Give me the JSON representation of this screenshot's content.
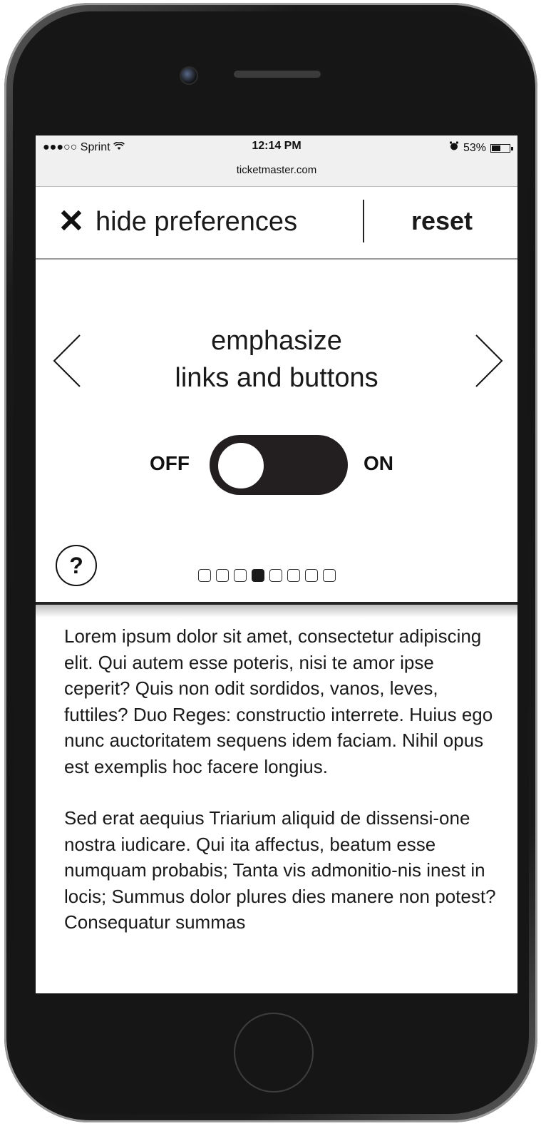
{
  "status_bar": {
    "carrier": "●●●○○ Sprint",
    "time": "12:14 PM",
    "url": "ticketmaster.com",
    "battery": "53%",
    "wifi_icon": "wifi-icon",
    "alarm_icon": "alarm-icon",
    "battery_level": 0.53
  },
  "toolbar": {
    "hide_label": "hide preferences",
    "reset_label": "reset"
  },
  "preference": {
    "title_line1": "emphasize",
    "title_line2": "links and buttons",
    "off_label": "OFF",
    "on_label": "ON",
    "toggle_state": "off",
    "help_label": "?",
    "page_count": 8,
    "current_page": 4
  },
  "content": {
    "paragraph1": "Lorem ipsum dolor sit amet, consectetur adipiscing elit. Qui autem esse poteris, nisi te amor ipse ceperit? Quis non odit sordidos, vanos, leves, futtiles? Duo Reges: constructio interrete. Huius ego nunc auctoritatem sequens idem faciam. Nihil opus est exemplis hoc facere longius.",
    "paragraph2": "Sed erat aequius Triarium aliquid de dissensi-one nostra iudicare. Qui ita affectus, beatum esse numquam probabis; Tanta vis admonitio-nis inest in locis; Summus dolor plures dies manere non potest? Consequatur summas"
  },
  "colors": {
    "dark": "#231f20",
    "statusbar_bg": "#f0f0f0",
    "frame": "#161616"
  }
}
